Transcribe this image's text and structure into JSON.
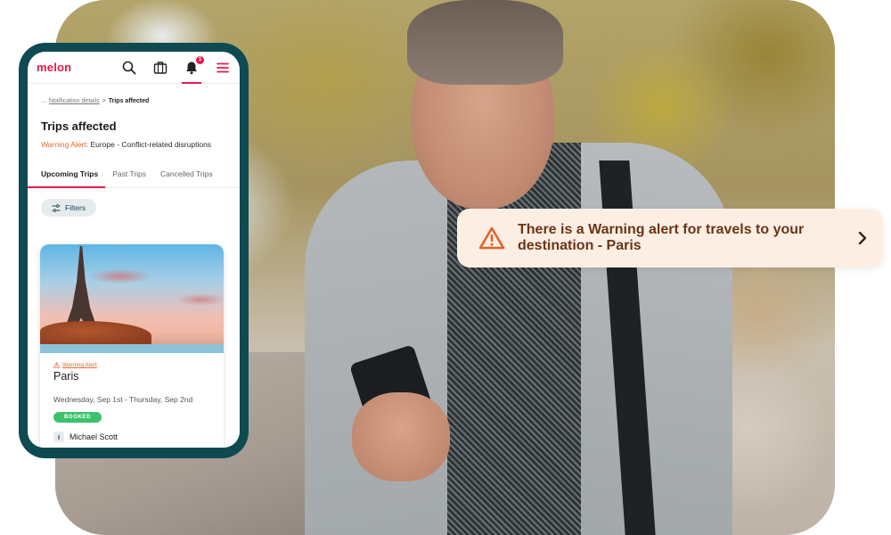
{
  "toast": {
    "message": "There is a Warning alert for travels to your destination - Paris",
    "icon": "warning-triangle-icon",
    "chevron_icon": "chevron-right-icon",
    "bg_color": "#fdeee3",
    "text_color": "#6b3419",
    "icon_color": "#e0622a"
  },
  "phone": {
    "app_bar": {
      "logo": "melon",
      "icons": [
        "search-icon",
        "briefcase-icon",
        "bell-icon",
        "menu-icon"
      ],
      "notification_count": "1"
    },
    "breadcrumb": {
      "ellipsis": "...",
      "parent": "Notification details",
      "separator": ">",
      "current": "Trips affected"
    },
    "page_title": "Trips affected",
    "alert": {
      "label": "Warning Alert:",
      "text": "Europe - Conflict-related disruptions"
    },
    "tabs": [
      {
        "label": "Upcoming Trips",
        "active": true
      },
      {
        "label": "Past Trips",
        "active": false
      },
      {
        "label": "Cancelled Trips",
        "active": false
      }
    ],
    "filters_label": "Filters",
    "trip_card": {
      "warning_label": "Warning Alert",
      "city": "Paris",
      "dates": "Wednesday, Sep 1st - Thursday, Sep 2nd",
      "status": "BOOKED",
      "traveler": "Michael Scott"
    }
  },
  "colors": {
    "brand": "#e8194b",
    "phone_frame": "#0f4a52",
    "warning": "#e8682a",
    "booked": "#3cc26d"
  }
}
